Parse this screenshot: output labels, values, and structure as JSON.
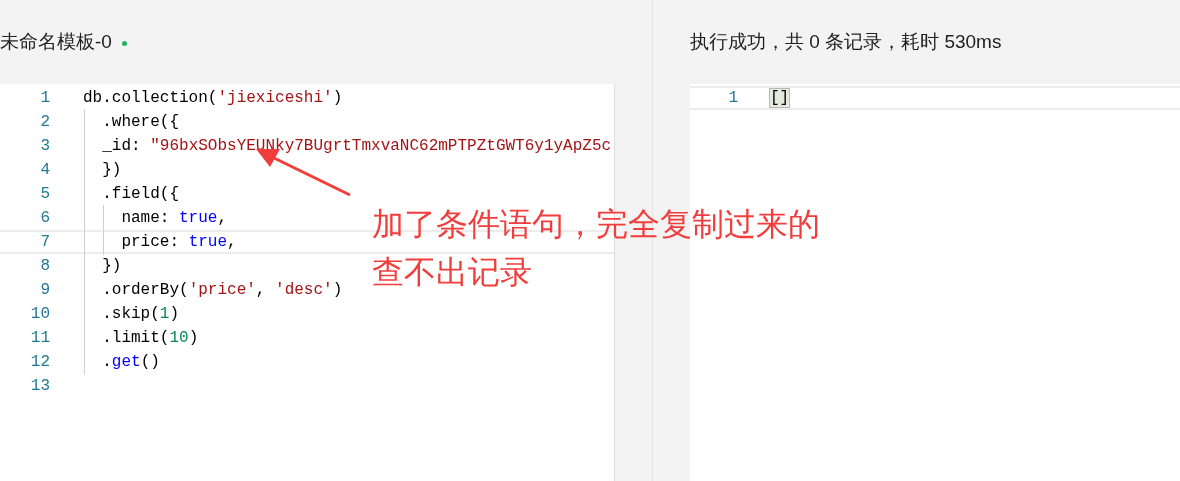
{
  "editor": {
    "title": "未命名模板-0",
    "unsaved": true,
    "lines": [
      {
        "number": "1",
        "active": false,
        "tokens": [
          {
            "kind": "plain",
            "text": "db.collection("
          },
          {
            "kind": "string",
            "text": "'jiexiceshi'"
          },
          {
            "kind": "plain",
            "text": ")"
          }
        ]
      },
      {
        "number": "2",
        "active": false,
        "tokens": [
          {
            "kind": "plain",
            "text": "  .where({"
          }
        ]
      },
      {
        "number": "3",
        "active": false,
        "tokens": [
          {
            "kind": "plain",
            "text": "  _id: "
          },
          {
            "kind": "string",
            "text": "\"96bxSObsYEUNky7BUgrtTmxvaNC62mPTPZtGWT6y1yApZ5c"
          }
        ]
      },
      {
        "number": "4",
        "active": false,
        "tokens": [
          {
            "kind": "plain",
            "text": "  })"
          }
        ]
      },
      {
        "number": "5",
        "active": false,
        "tokens": [
          {
            "kind": "plain",
            "text": "  .field({"
          }
        ]
      },
      {
        "number": "6",
        "active": false,
        "tokens": [
          {
            "kind": "plain",
            "text": "    name: "
          },
          {
            "kind": "keyword",
            "text": "true"
          },
          {
            "kind": "plain",
            "text": ","
          }
        ]
      },
      {
        "number": "7",
        "active": true,
        "tokens": [
          {
            "kind": "plain",
            "text": "    price: "
          },
          {
            "kind": "keyword",
            "text": "true"
          },
          {
            "kind": "plain",
            "text": ","
          }
        ]
      },
      {
        "number": "8",
        "active": false,
        "tokens": [
          {
            "kind": "plain",
            "text": "  })"
          }
        ]
      },
      {
        "number": "9",
        "active": false,
        "tokens": [
          {
            "kind": "plain",
            "text": "  .orderBy("
          },
          {
            "kind": "string",
            "text": "'price'"
          },
          {
            "kind": "plain",
            "text": ", "
          },
          {
            "kind": "string",
            "text": "'desc'"
          },
          {
            "kind": "plain",
            "text": ")"
          }
        ]
      },
      {
        "number": "10",
        "active": false,
        "tokens": [
          {
            "kind": "plain",
            "text": "  .skip("
          },
          {
            "kind": "number",
            "text": "1"
          },
          {
            "kind": "plain",
            "text": ")"
          }
        ]
      },
      {
        "number": "11",
        "active": false,
        "tokens": [
          {
            "kind": "plain",
            "text": "  .limit("
          },
          {
            "kind": "number",
            "text": "10"
          },
          {
            "kind": "plain",
            "text": ")"
          }
        ]
      },
      {
        "number": "12",
        "active": false,
        "tokens": [
          {
            "kind": "plain",
            "text": "  ."
          },
          {
            "kind": "keyword",
            "text": "get"
          },
          {
            "kind": "plain",
            "text": "()"
          }
        ]
      },
      {
        "number": "13",
        "active": false
      }
    ]
  },
  "annotation": {
    "text": "加了条件语句，完全复制过来的查不出记录"
  },
  "result": {
    "status": "执行成功，共 0 条记录，耗时 530ms",
    "lines": [
      {
        "number": "1",
        "active": true,
        "text": "[]"
      }
    ]
  }
}
